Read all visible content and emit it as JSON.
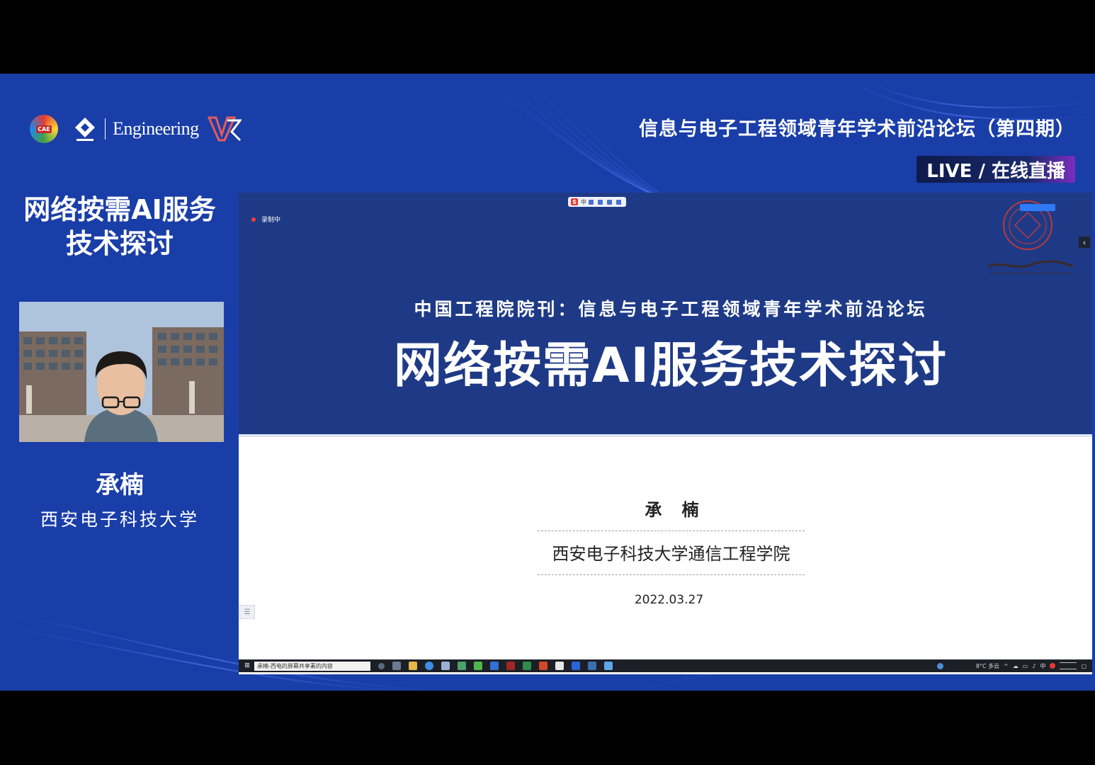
{
  "header": {
    "logos": {
      "cae_label": "CAE",
      "engineering_text": "Engineering"
    },
    "forum_title": "信息与电子工程领域青年学术前沿论坛（第四期）",
    "live_badge": "LIVE / 在线直播"
  },
  "sidebar": {
    "talk_title_line1": "网络按需AI服务",
    "talk_title_line2": "技术探讨",
    "speaker_name": "承楠",
    "speaker_org": "西安电子科技大学"
  },
  "shared_screen": {
    "recording_label": "录制中",
    "slide": {
      "subtitle": "中国工程院院刊：信息与电子工程领域青年学术前沿论坛",
      "title": "网络按需AI服务技术探讨",
      "author": "承 楠",
      "organization": "西安电子科技大学通信工程学院",
      "date": "2022.03.27"
    },
    "taskbar": {
      "search_text": "承楠-西电的屏幕共享",
      "search_suffix": "素的内容",
      "weather": "8°C 多云",
      "ime": "中"
    }
  },
  "colors": {
    "stage_blue": "#1a3ea8",
    "slide_blue": "#1e3a86",
    "live_purple": "#7b2cbf",
    "record_red": "#ff3b30"
  }
}
